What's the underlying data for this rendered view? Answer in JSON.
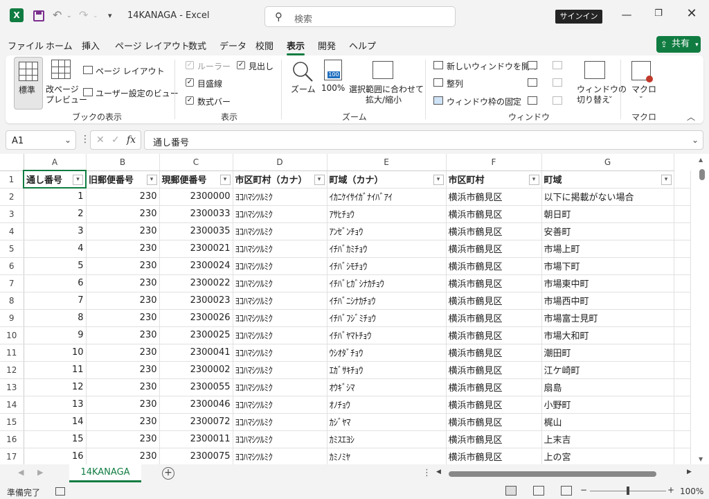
{
  "titlebar": {
    "app_logo": "X",
    "doc_title": "14KANAGA  -  Excel",
    "search_placeholder": "検索",
    "signin_label": "サインイン",
    "icons": [
      "excel-logo",
      "save-icon",
      "undo-icon",
      "redo-icon",
      "customize-qat-icon",
      "minimize-icon",
      "restore-icon",
      "close-icon"
    ]
  },
  "menu": {
    "tabs": [
      "ファイル",
      "ホーム",
      "挿入",
      "ページ レイアウト",
      "数式",
      "データ",
      "校閲",
      "表示",
      "開発",
      "ヘルプ"
    ],
    "active_tab": "表示",
    "share_label": "共有"
  },
  "ribbon": {
    "book_view": {
      "normal": "標準",
      "page_break_1": "改ページ",
      "page_break_2": "プレビュー",
      "page_layout": "ページ レイアウト",
      "custom_view": "ユーザー設定のビュー",
      "label": "ブックの表示"
    },
    "show": {
      "ruler": "ルーラー",
      "headings": "見出し",
      "gridlines": "目盛線",
      "formula_bar": "数式バー",
      "label": "表示",
      "checked": "✓"
    },
    "zoom": {
      "zoom": "ズーム",
      "zoom100": "100%",
      "zoom100_icon_text": "100",
      "zoom_sel_1": "選択範囲に合わせて",
      "zoom_sel_2": "拡大/縮小",
      "label": "ズーム"
    },
    "window": {
      "new_window": "新しいウィンドウを開く",
      "arrange": "整列",
      "freeze": "ウィンドウ枠の固定",
      "switch_1": "ウィンドウの",
      "switch_2": "切り替え",
      "label": "ウィンドウ"
    },
    "macro": {
      "macros": "マクロ",
      "label": "マクロ"
    }
  },
  "formula_bar": {
    "name_box": "A1",
    "fx": "fx",
    "content": "通し番号"
  },
  "grid": {
    "columns": [
      "A",
      "B",
      "C",
      "D",
      "E",
      "F",
      "G"
    ],
    "header_row": [
      "通し番号",
      "旧郵便番号",
      "現郵便番号",
      "市区町村（カナ）",
      "町域（カナ）",
      "市区町村",
      "町域"
    ],
    "rows": [
      [
        "1",
        "230",
        "2300000",
        "ﾖｺﾊﾏｼﾂﾙﾐｸ",
        "ｲｶﾆｹｲｻｲｶﾞﾅｲﾊﾞｱｲ",
        "横浜市鶴見区",
        "以下に掲載がない場合"
      ],
      [
        "2",
        "230",
        "2300033",
        "ﾖｺﾊﾏｼﾂﾙﾐｸ",
        "ｱｻﾋﾁｮｳ",
        "横浜市鶴見区",
        "朝日町"
      ],
      [
        "3",
        "230",
        "2300035",
        "ﾖｺﾊﾏｼﾂﾙﾐｸ",
        "ｱﾝｾﾞﾝﾁｮｳ",
        "横浜市鶴見区",
        "安善町"
      ],
      [
        "4",
        "230",
        "2300021",
        "ﾖｺﾊﾏｼﾂﾙﾐｸ",
        "ｲﾁﾊﾞｶﾐﾁｮｳ",
        "横浜市鶴見区",
        "市場上町"
      ],
      [
        "5",
        "230",
        "2300024",
        "ﾖｺﾊﾏｼﾂﾙﾐｸ",
        "ｲﾁﾊﾞｼﾓﾁｮｳ",
        "横浜市鶴見区",
        "市場下町"
      ],
      [
        "6",
        "230",
        "2300022",
        "ﾖｺﾊﾏｼﾂﾙﾐｸ",
        "ｲﾁﾊﾞﾋｶﾞｼﾅｶﾁｮｳ",
        "横浜市鶴見区",
        "市場東中町"
      ],
      [
        "7",
        "230",
        "2300023",
        "ﾖｺﾊﾏｼﾂﾙﾐｸ",
        "ｲﾁﾊﾞﾆｼﾅｶﾁｮｳ",
        "横浜市鶴見区",
        "市場西中町"
      ],
      [
        "8",
        "230",
        "2300026",
        "ﾖｺﾊﾏｼﾂﾙﾐｸ",
        "ｲﾁﾊﾞﾌｼﾞﾐﾁｮｳ",
        "横浜市鶴見区",
        "市場富士見町"
      ],
      [
        "9",
        "230",
        "2300025",
        "ﾖｺﾊﾏｼﾂﾙﾐｸ",
        "ｲﾁﾊﾞﾔﾏﾄﾁｮｳ",
        "横浜市鶴見区",
        "市場大和町"
      ],
      [
        "10",
        "230",
        "2300041",
        "ﾖｺﾊﾏｼﾂﾙﾐｸ",
        "ｳｼｵﾀﾞﾁｮｳ",
        "横浜市鶴見区",
        "潮田町"
      ],
      [
        "11",
        "230",
        "2300002",
        "ﾖｺﾊﾏｼﾂﾙﾐｸ",
        "ｴｶﾞｻｷﾁｮｳ",
        "横浜市鶴見区",
        "江ケ崎町"
      ],
      [
        "12",
        "230",
        "2300055",
        "ﾖｺﾊﾏｼﾂﾙﾐｸ",
        "ｵｳｷﾞｼﾏ",
        "横浜市鶴見区",
        "扇島"
      ],
      [
        "13",
        "230",
        "2300046",
        "ﾖｺﾊﾏｼﾂﾙﾐｸ",
        "ｵﾉﾁｮｳ",
        "横浜市鶴見区",
        "小野町"
      ],
      [
        "14",
        "230",
        "2300072",
        "ﾖｺﾊﾏｼﾂﾙﾐｸ",
        "ｶｼﾞﾔﾏ",
        "横浜市鶴見区",
        "梶山"
      ],
      [
        "15",
        "230",
        "2300011",
        "ﾖｺﾊﾏｼﾂﾙﾐｸ",
        "ｶﾐｽｴﾖｼ",
        "横浜市鶴見区",
        "上末吉"
      ],
      [
        "16",
        "230",
        "2300075",
        "ﾖｺﾊﾏｼﾂﾙﾐｸ",
        "ｶﾐﾉﾐﾔ",
        "横浜市鶴見区",
        "上の宮"
      ]
    ]
  },
  "sheet_tabs": {
    "active": "14KANAGA",
    "add_label": "+"
  },
  "status": {
    "ready": "準備完了",
    "zoom": "100%",
    "zoom_minus": "−",
    "zoom_plus": "+"
  },
  "colors": {
    "accent": "#107c41"
  }
}
